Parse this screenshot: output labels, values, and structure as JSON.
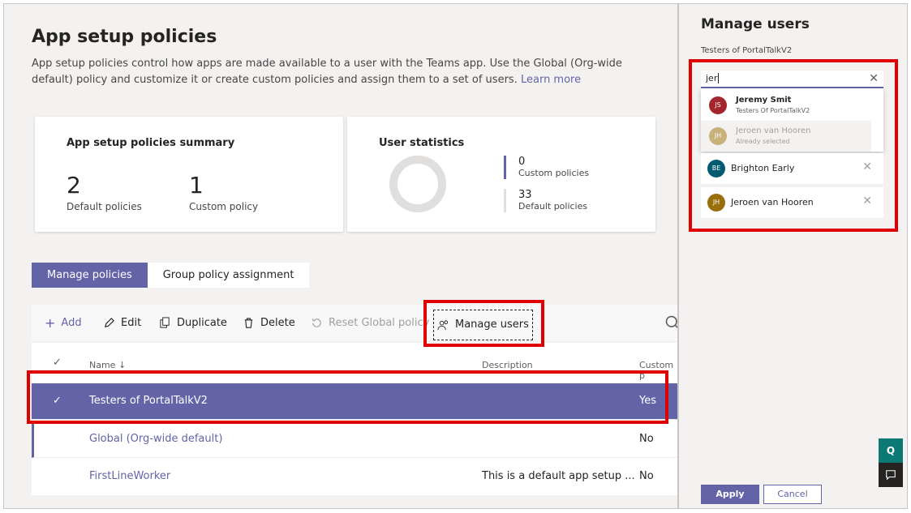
{
  "page": {
    "title": "App setup policies",
    "description": "App setup policies control how apps are made available to a user with the Teams app. Use the Global (Org-wide default) policy and customize it or create custom policies and assign them to a set of users.",
    "learn_more": "Learn more"
  },
  "summary": {
    "title": "App setup policies summary",
    "default_count": "2",
    "default_label": "Default policies",
    "custom_count": "1",
    "custom_label": "Custom policy"
  },
  "user_stats": {
    "title": "User statistics",
    "custom_count": "0",
    "custom_label": "Custom policies",
    "default_count": "33",
    "default_label": "Default policies"
  },
  "tabs": [
    {
      "label": "Manage policies",
      "active": true
    },
    {
      "label": "Group policy assignment",
      "active": false
    }
  ],
  "toolbar": {
    "add": "Add",
    "edit": "Edit",
    "duplicate": "Duplicate",
    "delete": "Delete",
    "reset": "Reset Global policy",
    "manage_users": "Manage users"
  },
  "table": {
    "headers": {
      "name": "Name",
      "sort_arrow": "↓",
      "description": "Description",
      "custom": "Custom p"
    },
    "rows": [
      {
        "name": "Testers of PortalTalkV2",
        "description": "",
        "custom": "Yes",
        "selected": true
      },
      {
        "name": "Global (Org-wide default)",
        "description": "",
        "custom": "No",
        "selected": false
      },
      {
        "name": "FirstLineWorker",
        "description": "This is a default app setup ...",
        "custom": "No",
        "selected": false
      }
    ]
  },
  "panel": {
    "title": "Manage users",
    "subtitle": "Testers of PortalTalkV2",
    "search_value": "jer",
    "suggestions": [
      {
        "initials": "JS",
        "name": "Jeremy Smit",
        "sub": "Testers Of PortalTalkV2",
        "color": "#a4262c"
      },
      {
        "initials": "JH",
        "name": "Jeroen van Hooren",
        "sub": "Already selected",
        "color": "#c8b27a"
      }
    ],
    "selected": [
      {
        "initials": "BE",
        "name": "Brighton Early",
        "color": "#005b70"
      },
      {
        "initials": "JH",
        "name": "Jeroen van Hooren",
        "color": "#986f0b"
      }
    ],
    "apply": "Apply",
    "cancel": "Cancel"
  },
  "colors": {
    "accent": "#6264a7",
    "highlight": "#e00000"
  }
}
